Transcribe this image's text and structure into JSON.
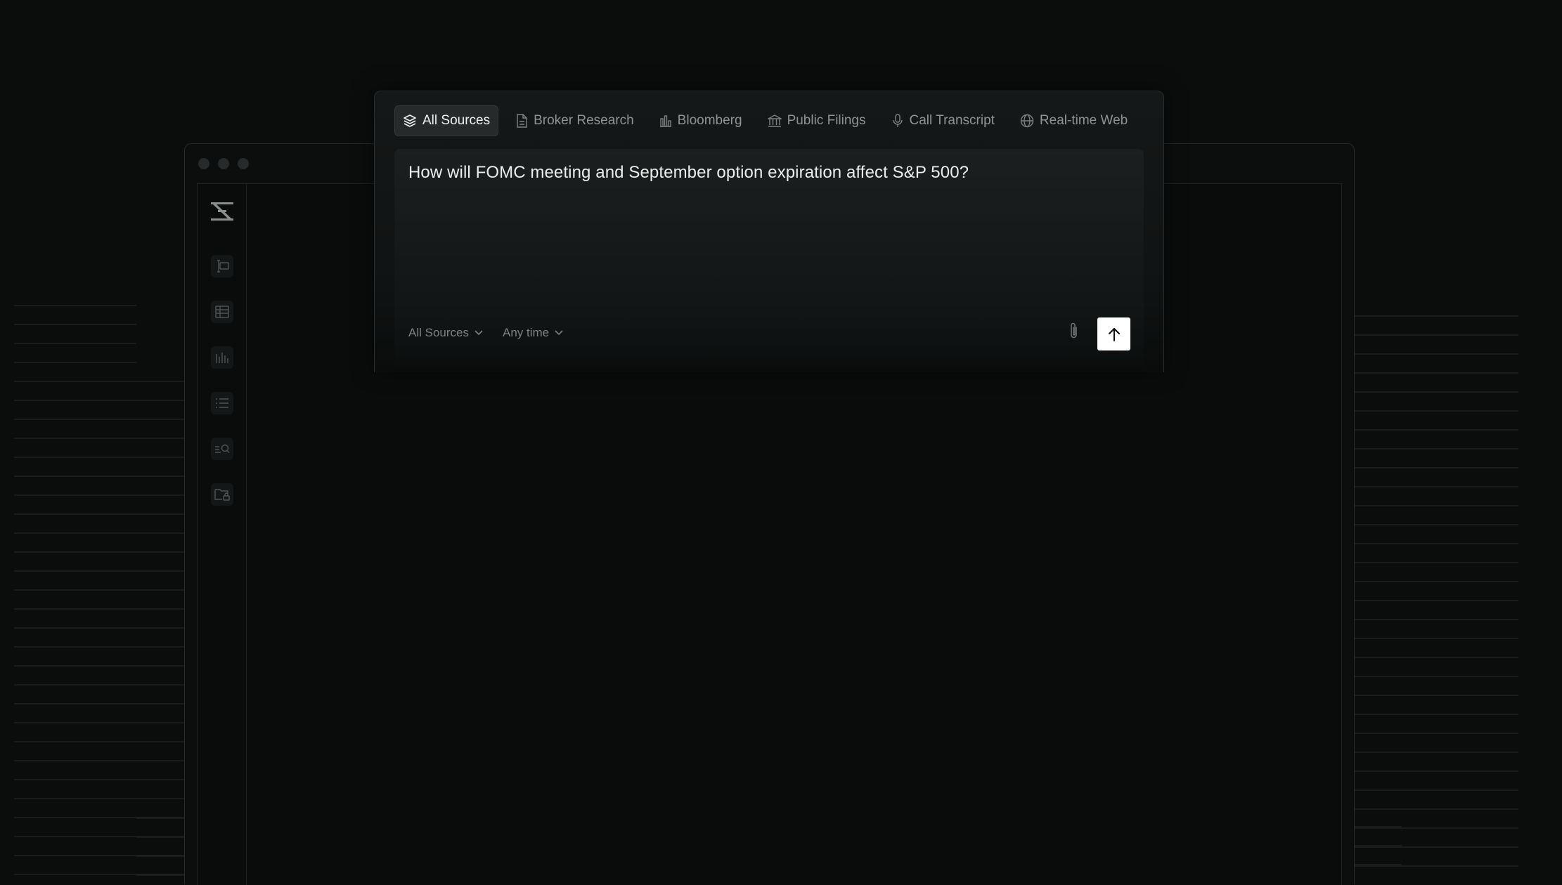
{
  "source_tabs": [
    {
      "label": "All Sources",
      "icon": "layers-icon",
      "active": true
    },
    {
      "label": "Broker Research",
      "icon": "document-icon",
      "active": false
    },
    {
      "label": "Bloomberg",
      "icon": "bar-chart-icon",
      "active": false
    },
    {
      "label": "Public Filings",
      "icon": "bank-icon",
      "active": false
    },
    {
      "label": "Call Transcript",
      "icon": "microphone-icon",
      "active": false
    },
    {
      "label": "Real-time Web",
      "icon": "globe-icon",
      "active": false
    }
  ],
  "query": {
    "text": "How will FOMC meeting and September option expiration affect S&P 500?"
  },
  "filters": {
    "source_label": "All Sources",
    "time_label": "Any time"
  },
  "sidebar": {
    "icons": [
      "text-cursor-icon",
      "table-icon",
      "column-chart-icon",
      "list-icon",
      "search-list-icon",
      "locked-folder-icon"
    ]
  },
  "colors": {
    "background": "#0b0d0d",
    "send_button": "#ffffff",
    "active_tab": "#262a2a"
  }
}
